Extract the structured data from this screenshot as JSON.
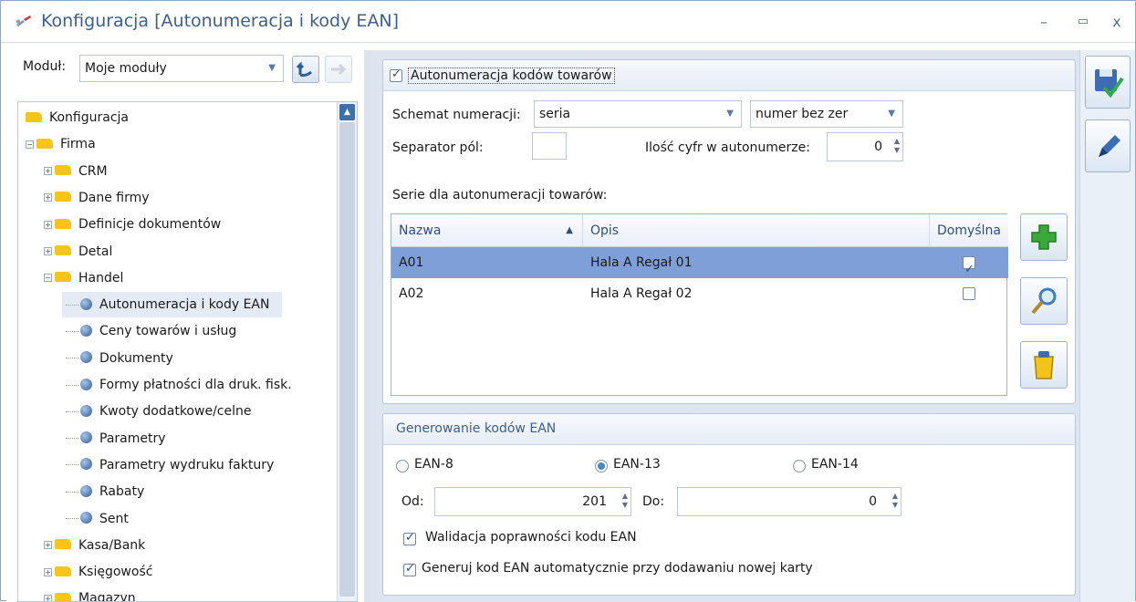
{
  "window": {
    "title": "Konfiguracja [Autonumeracja i kody EAN]",
    "minimize": "–",
    "maximize": "▭",
    "close": "x"
  },
  "module": {
    "label": "Moduł:",
    "value": "Moje moduły"
  },
  "tree": [
    {
      "label": "Konfiguracja",
      "level": 0,
      "icon": "folder",
      "expand": ""
    },
    {
      "label": "Firma",
      "level": 1,
      "icon": "folder",
      "expand": "−"
    },
    {
      "label": "CRM",
      "level": 2,
      "icon": "folder",
      "expand": "+"
    },
    {
      "label": "Dane firmy",
      "level": 2,
      "icon": "folder",
      "expand": "+"
    },
    {
      "label": "Definicje dokumentów",
      "level": 2,
      "icon": "folder",
      "expand": "+"
    },
    {
      "label": "Detal",
      "level": 2,
      "icon": "folder",
      "expand": "+"
    },
    {
      "label": "Handel",
      "level": 2,
      "icon": "folder",
      "expand": "−"
    },
    {
      "label": "Autonumeracja i kody EAN",
      "level": 3,
      "icon": "leaf",
      "expand": "",
      "selected": true
    },
    {
      "label": "Ceny towarów i usług",
      "level": 3,
      "icon": "leaf",
      "expand": ""
    },
    {
      "label": "Dokumenty",
      "level": 3,
      "icon": "leaf",
      "expand": ""
    },
    {
      "label": "Formy płatności dla druk. fisk.",
      "level": 3,
      "icon": "leaf",
      "expand": ""
    },
    {
      "label": "Kwoty dodatkowe/celne",
      "level": 3,
      "icon": "leaf",
      "expand": ""
    },
    {
      "label": "Parametry",
      "level": 3,
      "icon": "leaf",
      "expand": ""
    },
    {
      "label": "Parametry wydruku faktury",
      "level": 3,
      "icon": "leaf",
      "expand": ""
    },
    {
      "label": "Rabaty",
      "level": 3,
      "icon": "leaf",
      "expand": ""
    },
    {
      "label": "Sent",
      "level": 3,
      "icon": "leaf",
      "expand": ""
    },
    {
      "label": "Kasa/Bank",
      "level": 2,
      "icon": "folder",
      "expand": "+"
    },
    {
      "label": "Księgowość",
      "level": 2,
      "icon": "folder",
      "expand": "+"
    },
    {
      "label": "Magazyn",
      "level": 2,
      "icon": "folder",
      "expand": "+"
    }
  ],
  "autonum": {
    "checkbox_label": "Autonumeracja kodów towarów",
    "schema_label": "Schemat numeracji:",
    "schema_value": "seria",
    "schema2_value": "numer bez zer",
    "separator_label": "Separator pól:",
    "separator_value": "",
    "digits_label": "Ilość cyfr w autonumerze:",
    "digits_value": "0",
    "series_label": "Serie dla autonumeracji towarów:"
  },
  "grid": {
    "headers": {
      "name": "Nazwa",
      "desc": "Opis",
      "default": "Domyślna"
    },
    "sort_indicator": "▲",
    "rows": [
      {
        "name": "A01",
        "desc": "Hala A Regał 01",
        "default": true
      },
      {
        "name": "A02",
        "desc": "Hala A Regał 02",
        "default": false
      }
    ]
  },
  "ean": {
    "title": "Generowanie kodów EAN",
    "options": [
      "EAN-8",
      "EAN-13",
      "EAN-14"
    ],
    "selected": "EAN-13",
    "from_label": "Od:",
    "from_value": "201",
    "to_label": "Do:",
    "to_value": "0",
    "validate_label": "Walidacja poprawności kodu EAN",
    "generate_label": "Generuj kod EAN automatycznie przy dodawaniu nowej karty"
  },
  "colors": {
    "accent": "#3d5f8e",
    "selected_row": "#7f9fd9",
    "folder": "#f5c518"
  }
}
